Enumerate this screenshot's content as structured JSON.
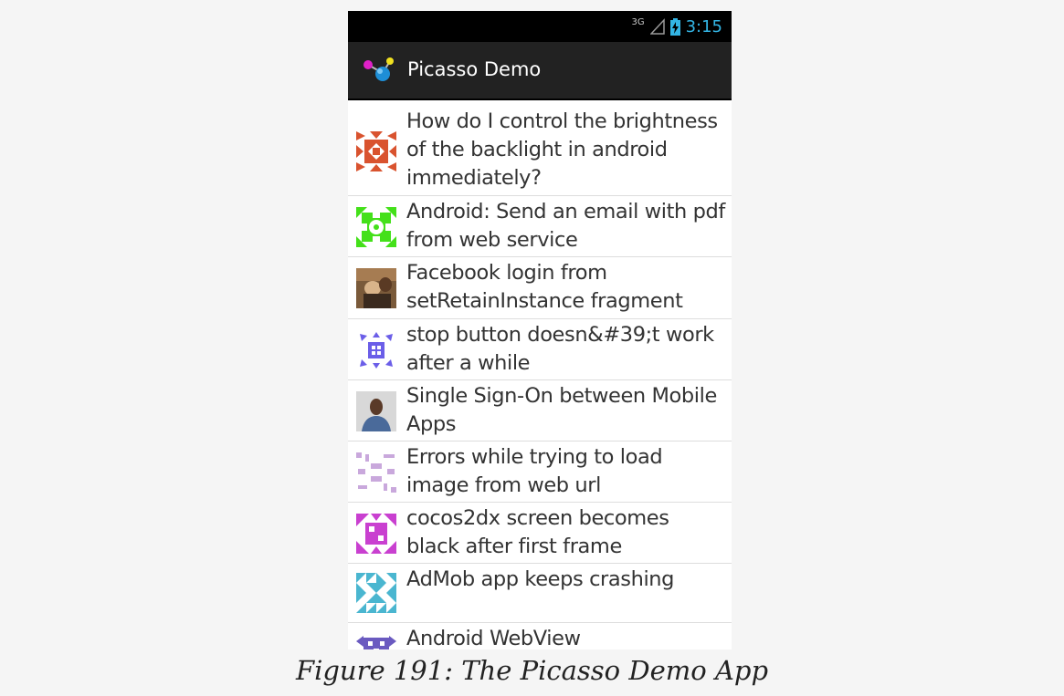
{
  "status_bar": {
    "network_type": "3G",
    "time": "3:15",
    "icons": [
      "signal-icon",
      "battery-charging-icon"
    ]
  },
  "action_bar": {
    "title": "Picasso Demo",
    "icon": "picasso-app-icon"
  },
  "questions": [
    {
      "title": "How do I control the brightness of the backlight in android immediately?",
      "thumb_color": "#d9532f"
    },
    {
      "title": "Android: Send an email with pdf from web service",
      "thumb_color": "#44e01a"
    },
    {
      "title": "Facebook login from setRetainInstance fragment",
      "thumb_color": "#6b4a30"
    },
    {
      "title": "stop button doesn&#39;t work after a while",
      "thumb_color": "#6b5ee8"
    },
    {
      "title": "Single Sign-On between Mobile Apps",
      "thumb_color": "#4a6a9a"
    },
    {
      "title": "Errors while trying to load image from web url",
      "thumb_color": "#c9a8dc"
    },
    {
      "title": "cocos2dx screen becomes black after first frame",
      "thumb_color": "#c940d0"
    },
    {
      "title": "AdMob app keeps crashing",
      "thumb_color": "#4ab6d0"
    },
    {
      "title": "Android WebView",
      "thumb_color": "#6a5ac0"
    }
  ],
  "caption": "Figure 191: The Picasso Demo App"
}
